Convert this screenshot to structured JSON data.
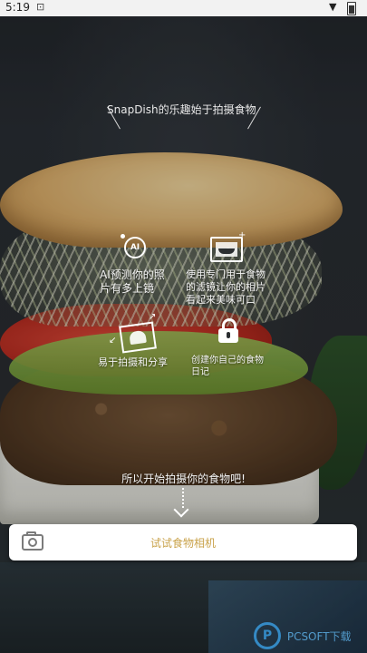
{
  "status_bar": {
    "time": "5:19"
  },
  "tagline": "SnapDish的乐趣始于拍摄食物",
  "features": {
    "ai": {
      "icon_text": "AI",
      "label": "AI预测你的照片有多上镜"
    },
    "filter": {
      "label": "使用专门用于食物的滤镜让你的相片看起来美味可口"
    },
    "share": {
      "label": "易于拍摄和分享"
    },
    "diary": {
      "label": "创建你自己的食物日记"
    }
  },
  "cta": {
    "prompt": "所以开始拍摄你的食物吧!",
    "button_label": "试试食物相机"
  },
  "watermark": {
    "letter": "P",
    "text": "PCSOFT下载"
  },
  "colors": {
    "button_text": "#c9a24a",
    "button_bg": "#ffffff"
  }
}
